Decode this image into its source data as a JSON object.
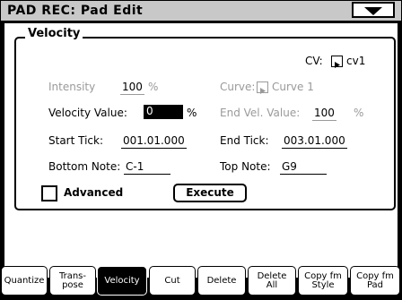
{
  "title": "PAD REC: Pad Edit",
  "menu_icon": "triangle-down-icon",
  "group": {
    "title": "Velocity",
    "cv_label": "CV:",
    "cv_value": "cv1",
    "intensity_label": "Intensity",
    "intensity_value": "100",
    "intensity_unit": "%",
    "curve_label": "Curve:",
    "curve_value": "Curve 1",
    "velocity_value_label": "Velocity Value:",
    "velocity_value": "0",
    "velocity_value_unit": "%",
    "end_vel_label": "End Vel. Value:",
    "end_vel_value": "100",
    "end_vel_unit": "%",
    "start_tick_label": "Start Tick:",
    "start_tick_value": "001.01.000",
    "end_tick_label": "End Tick:",
    "end_tick_value": "003.01.000",
    "bottom_note_label": "Bottom Note:",
    "bottom_note_value": "C-1",
    "top_note_label": "Top Note:",
    "top_note_value": "G9",
    "advanced_label": "Advanced",
    "advanced_checked": false,
    "execute_label": "Execute"
  },
  "tabs": [
    {
      "line1": "Quantize",
      "line2": ""
    },
    {
      "line1": "Trans-",
      "line2": "pose"
    },
    {
      "line1": "Velocity",
      "line2": ""
    },
    {
      "line1": "Cut",
      "line2": ""
    },
    {
      "line1": "Delete",
      "line2": ""
    },
    {
      "line1": "Delete",
      "line2": "All"
    },
    {
      "line1": "Copy fm",
      "line2": "Style"
    },
    {
      "line1": "Copy fm",
      "line2": "Pad"
    }
  ],
  "active_tab": 2
}
